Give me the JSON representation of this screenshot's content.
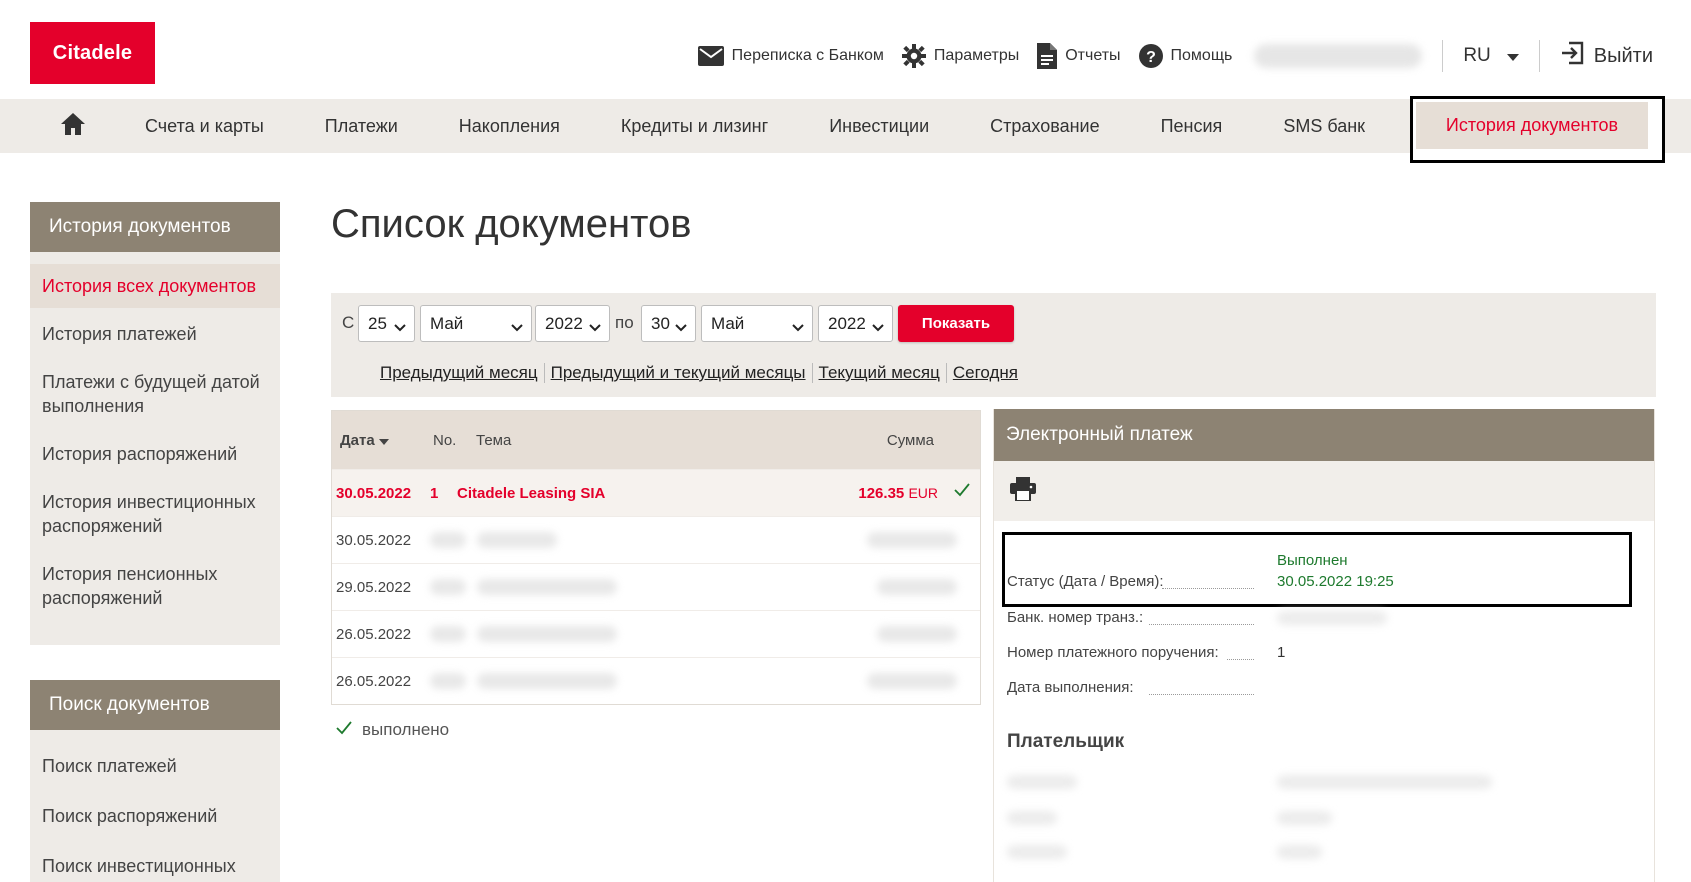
{
  "header": {
    "logo": "Citadele",
    "links": [
      {
        "label": "Переписка с Банком",
        "icon": "envelope-icon"
      },
      {
        "label": "Параметры",
        "icon": "gear-icon"
      },
      {
        "label": "Отчеты",
        "icon": "document-icon"
      },
      {
        "label": "Помощь",
        "icon": "help-icon"
      }
    ],
    "language": "RU",
    "logout": "Выйти"
  },
  "nav": {
    "items": [
      "Счета и карты",
      "Платежи",
      "Накопления",
      "Кредиты и лизинг",
      "Инвестиции",
      "Страхование",
      "Пенсия",
      "SMS банк"
    ],
    "active": "История документов"
  },
  "sidebar": {
    "history": {
      "title": "История документов",
      "items": [
        "История всех документов",
        "История платежей",
        "Платежи с будущей датой выполнения",
        "История распоряжений",
        "История инвестиционных распоряжений",
        "История пенсионных распоряжений"
      ]
    },
    "search": {
      "title": "Поиск документов",
      "items": [
        "Поиск платежей",
        "Поиск распоряжений",
        "Поиск инвестиционных"
      ]
    }
  },
  "main": {
    "title": "Список документов",
    "filter": {
      "from_label": "С",
      "to_label": "по",
      "from_day": "25",
      "from_month": "Май",
      "from_year": "2022",
      "to_day": "30",
      "to_month": "Май",
      "to_year": "2022",
      "show_button": "Показать",
      "quick_links": [
        "Предыдущий месяц",
        "Предыдущий и текущий месяцы",
        "Текущий месяц",
        "Сегодня"
      ]
    },
    "table": {
      "headers": {
        "date": "Дата",
        "no": "No.",
        "topic": "Тема",
        "sum": "Сумма"
      },
      "rows": [
        {
          "date": "30.05.2022",
          "no": "1",
          "topic": "Citadele Leasing SIA",
          "sum": "126.35",
          "currency": "EUR"
        },
        {
          "date": "30.05.2022"
        },
        {
          "date": "29.05.2022"
        },
        {
          "date": "26.05.2022"
        },
        {
          "date": "26.05.2022"
        }
      ],
      "legend": "выполнено"
    }
  },
  "detail": {
    "title": "Электронный платеж",
    "status_label": "Статус (Дата / Время):",
    "status_value": "Выполнен",
    "status_datetime": "30.05.2022 19:25",
    "trans_label": "Банк. номер транз.:",
    "order_label": "Номер платежного поручения:",
    "order_value": "1",
    "exec_label": "Дата выполнения:",
    "payer_title": "Плательщик"
  },
  "colors": {
    "brand": "#e4002b",
    "nav_bg": "#eeebe7",
    "panel_head": "#8d8373",
    "success": "#1e7a2e"
  }
}
